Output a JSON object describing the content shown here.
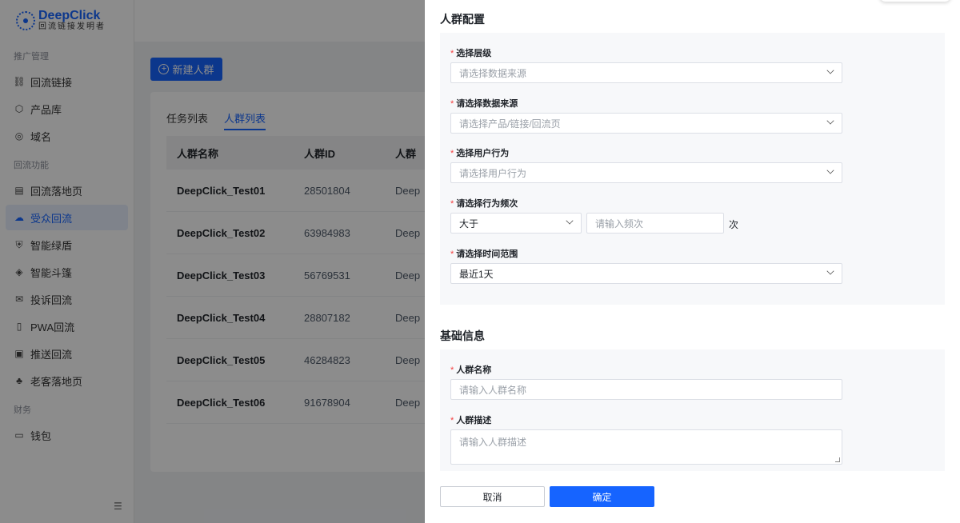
{
  "logo": {
    "brand": "DeepClick",
    "tagline": "回流链接发明者"
  },
  "sidebar": {
    "sections": [
      {
        "title": "推广管理",
        "items": [
          {
            "label": "回流链接",
            "icon": "link-icon",
            "glyph": "⛓"
          },
          {
            "label": "产品库",
            "icon": "cube-icon",
            "glyph": "⬡"
          },
          {
            "label": "域名",
            "icon": "globe-icon",
            "glyph": "◎"
          }
        ]
      },
      {
        "title": "回流功能",
        "items": [
          {
            "label": "回流落地页",
            "icon": "page-icon",
            "glyph": "▤"
          },
          {
            "label": "受众回流",
            "icon": "cloud-icon",
            "glyph": "☁",
            "active": true
          },
          {
            "label": "智能绿盾",
            "icon": "shield-icon",
            "glyph": "⛨"
          },
          {
            "label": "智能斗篷",
            "icon": "cloak-icon",
            "glyph": "◈"
          },
          {
            "label": "投诉回流",
            "icon": "complaint-icon",
            "glyph": "✉"
          },
          {
            "label": "PWA回流",
            "icon": "mobile-icon",
            "glyph": "▯"
          },
          {
            "label": "推送回流",
            "icon": "push-icon",
            "glyph": "▣"
          },
          {
            "label": "老客落地页",
            "icon": "returning-customer-icon",
            "glyph": "♣"
          }
        ]
      },
      {
        "title": "财务",
        "items": [
          {
            "label": "钱包",
            "icon": "wallet-icon",
            "glyph": "▭"
          }
        ]
      }
    ],
    "collapse_glyph": "☰"
  },
  "main": {
    "new_button": "新建人群",
    "tabs": [
      {
        "label": "任务列表"
      },
      {
        "label": "人群列表",
        "active": true
      }
    ],
    "table": {
      "columns": [
        "人群名称",
        "人群ID",
        "人群"
      ],
      "rows": [
        [
          "DeepClick_Test01",
          "28501804",
          "Deep"
        ],
        [
          "DeepClick_Test02",
          "63984983",
          "Deep"
        ],
        [
          "DeepClick_Test03",
          "56769531",
          "Deep"
        ],
        [
          "DeepClick_Test04",
          "28807182",
          "Deep"
        ],
        [
          "DeepClick_Test05",
          "46284823",
          "Deep"
        ],
        [
          "DeepClick_Test06",
          "91678904",
          "Deep"
        ]
      ]
    }
  },
  "drawer": {
    "config_title": "人群配置",
    "level_label": "选择层级",
    "level_placeholder": "请选择数据来源",
    "source_label": "请选择数据来源",
    "source_placeholder": "请选择产品/链接/回流页",
    "behavior_label": "选择用户行为",
    "behavior_placeholder": "请选择用户行为",
    "freq_label": "请选择行为频次",
    "freq_operator": "大于",
    "freq_placeholder": "请输入频次",
    "freq_suffix": "次",
    "time_label": "请选择时间范围",
    "time_value": "最近1天",
    "basic_title": "基础信息",
    "name_label": "人群名称",
    "name_placeholder": "请输入人群名称",
    "desc_label": "人群描述",
    "desc_placeholder": "请输入人群描述",
    "required_mark": "*",
    "cancel_button": "取消",
    "confirm_button": "确定"
  },
  "colors": {
    "primary": "#1664ff",
    "required": "#f53f3f",
    "overlay": "rgba(0,0,0,0.45)"
  }
}
